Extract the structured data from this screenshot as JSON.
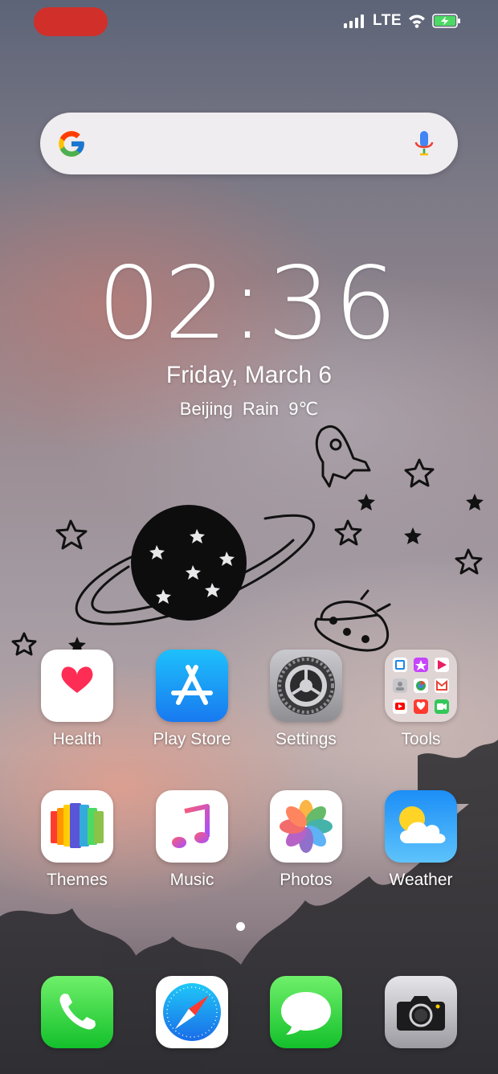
{
  "status_bar": {
    "network_label": "LTE",
    "recording_color": "#d12f2a"
  },
  "search": {
    "left_icon": "google-g-icon",
    "right_icon": "microphone-icon"
  },
  "clock": {
    "time": "02:36",
    "date": "Friday, March 6",
    "weather": "Beijing  Rain  9℃"
  },
  "home_apps": [
    {
      "label": "Health",
      "icon": "health-heart-icon"
    },
    {
      "label": "Play Store",
      "icon": "app-store-icon"
    },
    {
      "label": "Settings",
      "icon": "gear-icon"
    },
    {
      "label": "Tools",
      "icon": "folder-icon"
    },
    {
      "label": "Themes",
      "icon": "themes-icon"
    },
    {
      "label": "Music",
      "icon": "music-note-icon"
    },
    {
      "label": "Photos",
      "icon": "photos-flower-icon"
    },
    {
      "label": "Weather",
      "icon": "sun-cloud-icon"
    }
  ],
  "pagination": {
    "current_page": 1,
    "total_pages": 1
  },
  "dock": [
    {
      "name": "Phone",
      "icon": "phone-icon"
    },
    {
      "name": "Safari",
      "icon": "compass-icon"
    },
    {
      "name": "Messages",
      "icon": "message-bubble-icon"
    },
    {
      "name": "Camera",
      "icon": "camera-icon"
    }
  ]
}
